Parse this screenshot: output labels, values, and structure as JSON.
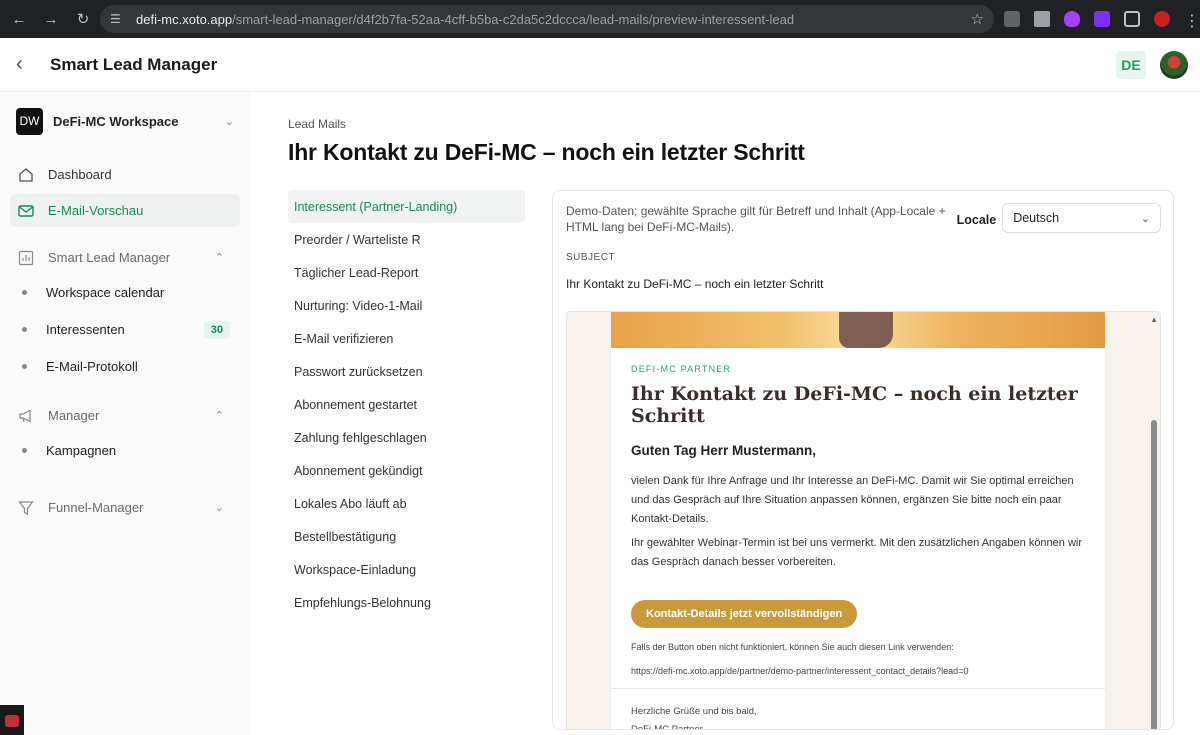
{
  "browser": {
    "url_host": "defi-mc.xoto.app",
    "url_path": "/smart-lead-manager/d4f2b7fa-52aa-4cff-b5ba-c2da5c2dccca/lead-mails/preview-interessent-lead"
  },
  "header": {
    "title": "Smart Lead Manager",
    "lang": "DE"
  },
  "sidebar": {
    "workspace": {
      "logo": "DW",
      "name": "DeFi-MC Workspace"
    },
    "items": [
      {
        "label": "Dashboard",
        "icon": "home-icon"
      },
      {
        "label": "E-Mail-Vorschau",
        "icon": "mail-icon"
      }
    ],
    "groups": [
      {
        "label": "Smart Lead Manager",
        "icon": "chart-icon",
        "expanded": true,
        "children": [
          {
            "label": "Workspace calendar"
          },
          {
            "label": "Interessenten",
            "count": "30"
          },
          {
            "label": "E-Mail-Protokoll"
          }
        ]
      },
      {
        "label": "Manager",
        "icon": "megaphone-icon",
        "expanded": true,
        "children": [
          {
            "label": "Kampagnen"
          }
        ]
      },
      {
        "label": "Funnel-Manager",
        "icon": "funnel-icon",
        "expanded": false,
        "children": []
      }
    ]
  },
  "main": {
    "breadcrumb": "Lead Mails",
    "title": "Ihr Kontakt zu DeFi-MC – noch ein letzter Schritt",
    "templates": [
      "Interessent (Partner-Landing)",
      "Preorder / Warteliste R",
      "Täglicher Lead-Report",
      "Nurturing: Video-1-Mail",
      "E-Mail verifizieren",
      "Passwort zurücksetzen",
      "Abonnement gestartet",
      "Zahlung fehlgeschlagen",
      "Abonnement gekündigt",
      "Lokales Abo läuft ab",
      "Bestellbestätigung",
      "Workspace-Einladung",
      "Empfehlungs-Belohnung"
    ],
    "panel": {
      "demo_note": "Demo-Daten; gewählte Sprache gilt für Betreff und Inhalt (App-Locale + HTML lang bei DeFi-MC-Mails).",
      "locale_label": "Locale",
      "locale_value": "Deutsch",
      "subject_label": "SUBJECT",
      "subject": "Ihr Kontakt zu DeFi-MC – noch ein letzter Schritt"
    },
    "email": {
      "eyebrow": "DEFI-MC PARTNER",
      "title": "Ihr Kontakt zu DeFi-MC – noch ein letzter Schritt",
      "greeting": "Guten Tag Herr Mustermann,",
      "para1": "vielen Dank für Ihre Anfrage und Ihr Interesse an DeFi-MC. Damit wir Sie optimal erreichen und das Gespräch auf Ihre Situation anpassen können, ergänzen Sie bitte noch ein paar Kontakt-Details.",
      "para2": "Ihr gewählter Webinar-Termin ist bei uns vermerkt. Mit den zusätzlichen Angaben können wir das Gespräch danach besser vorbereiten.",
      "cta": "Kontakt-Details jetzt vervollständigen",
      "fallback": "Falls der Button oben nicht funktioniert, können Sie auch diesen Link verwenden:",
      "link": "https://defi-mc.xoto.app/de/partner/demo-partner/interessent_contact_details?lead=0",
      "signoff": "Herzliche Grüße und bis bald,",
      "signature": "DeFi-MC Partner"
    }
  }
}
